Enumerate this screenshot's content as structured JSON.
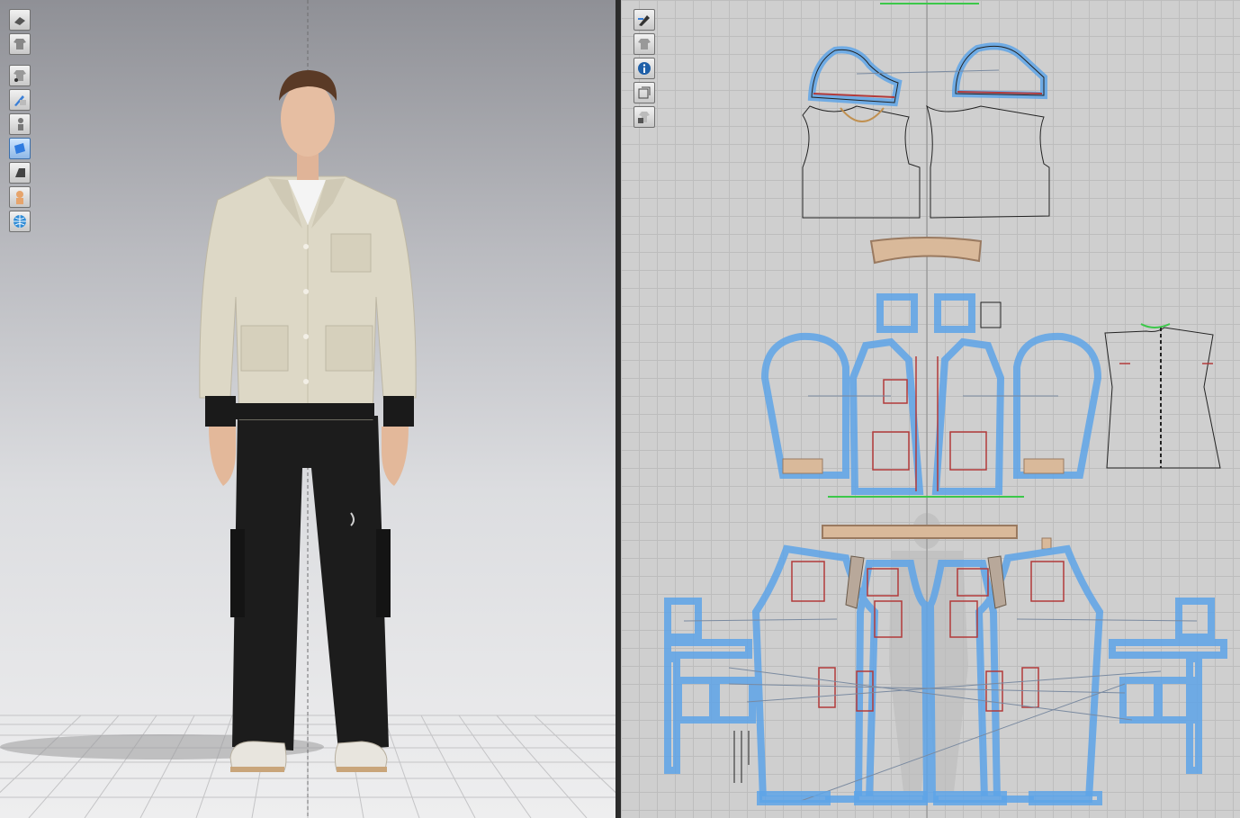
{
  "app": {
    "panels": [
      "3d-garment-window",
      "2d-pattern-window"
    ]
  },
  "toolbar3d": {
    "tools": [
      {
        "name": "garment-display-icon"
      },
      {
        "name": "show-garment-icon"
      },
      {
        "name": "show-avatar-garment-icon"
      },
      {
        "name": "texture-brush-icon"
      },
      {
        "name": "avatar-display-icon"
      },
      {
        "name": "fabric-render-icon"
      },
      {
        "name": "shading-icon"
      },
      {
        "name": "skin-icon"
      },
      {
        "name": "environment-globe-icon"
      }
    ]
  },
  "toolbar2d": {
    "tools": [
      {
        "name": "pattern-pen-icon"
      },
      {
        "name": "show-2d-garment-icon"
      },
      {
        "name": "info-icon"
      },
      {
        "name": "pattern-outline-icon"
      },
      {
        "name": "lock-garment-icon"
      }
    ]
  },
  "colors": {
    "pattern_blue": "#5ea4e8",
    "seam_red": "#b23a3a",
    "pattern_line": "#222222",
    "fabric_beige": "#ddd8c6",
    "trouser_black": "#1c1c1c",
    "grid_bg": "#cfcfcf",
    "accent_green": "#3cc84a"
  }
}
